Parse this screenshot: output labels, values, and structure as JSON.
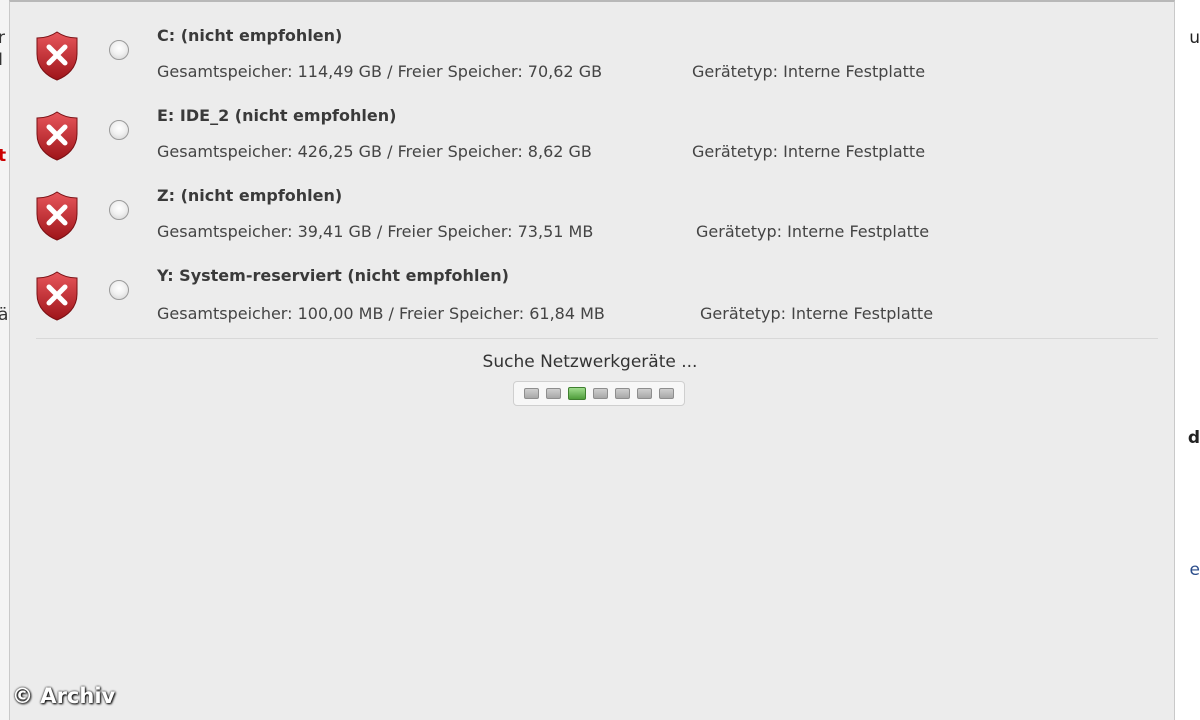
{
  "drives": [
    {
      "title": "C:  (nicht empfohlen)",
      "memory": "Gesamtspeicher: 114,49 GB / Freier Speicher: 70,62 GB",
      "device_type": "Gerätetyp: Interne Festplatte",
      "icon": "shield-error-icon"
    },
    {
      "title": "E: IDE_2 (nicht empfohlen)",
      "memory": "Gesamtspeicher: 426,25 GB / Freier Speicher: 8,62 GB",
      "device_type": "Gerätetyp: Interne Festplatte",
      "icon": "shield-error-icon"
    },
    {
      "title": "Z:  (nicht empfohlen)",
      "memory": "Gesamtspeicher: 39,41 GB / Freier Speicher: 73,51 MB",
      "device_type": "Gerätetyp: Interne Festplatte",
      "icon": "shield-error-icon"
    },
    {
      "title": "Y: System-reserviert (nicht empfohlen)",
      "memory": "Gesamtspeicher: 100,00 MB / Freier Speicher: 61,84 MB",
      "device_type": "Gerätetyp: Interne Festplatte",
      "icon": "shield-error-icon"
    }
  ],
  "network_search": {
    "label": "Suche Netzwerkgeräte ...",
    "progress_segments": 7,
    "active_segment": 3
  },
  "watermark": "© Archiv",
  "colors": {
    "dialog_bg": "#ececec",
    "shield_red": "#c8252c",
    "progress_active": "#5aab44"
  }
}
